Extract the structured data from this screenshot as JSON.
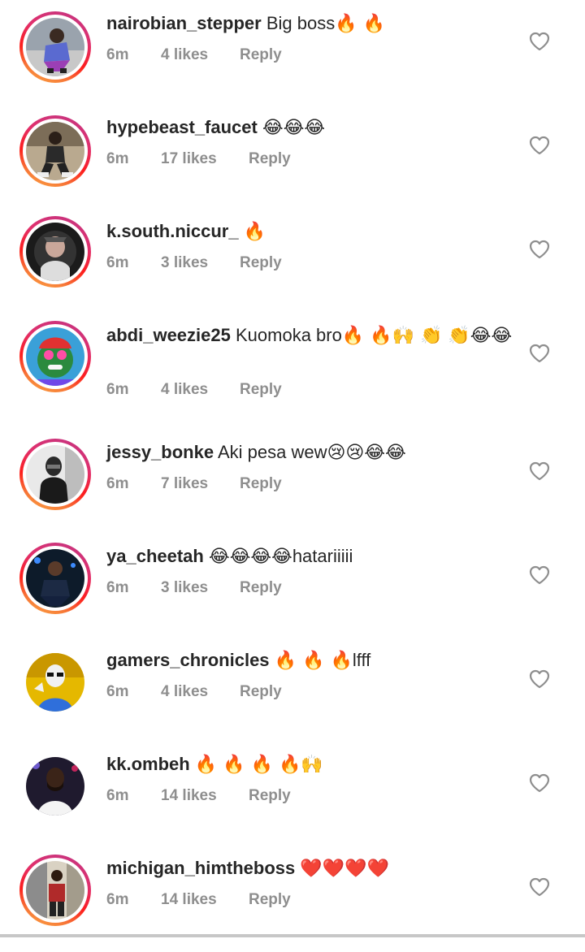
{
  "comments": [
    {
      "username": "nairobian_stepper",
      "text": "Big boss",
      "emoji": "🔥 🔥",
      "time": "6m",
      "likes": "4 likes",
      "reply_label": "Reply"
    },
    {
      "username": "hypebeast_faucet",
      "text": "",
      "emoji": "😂😂😂",
      "time": "6m",
      "likes": "17 likes",
      "reply_label": "Reply"
    },
    {
      "username": "k.south.niccur_",
      "text": "",
      "emoji": "🔥",
      "time": "6m",
      "likes": "3 likes",
      "reply_label": "Reply"
    },
    {
      "username": "abdi_weezie25",
      "text": "Kuomoka bro",
      "emoji": "🔥 🔥🙌 👏 👏😂😂",
      "time": "6m",
      "likes": "4 likes",
      "reply_label": "Reply"
    },
    {
      "username": "jessy_bonke",
      "text": "Aki pesa wew",
      "emoji": "😢😢😂😂",
      "time": "6m",
      "likes": "7 likes",
      "reply_label": "Reply"
    },
    {
      "username": "ya_cheetah",
      "text": "hatariiiii",
      "emoji": "😂😂😂😂",
      "time": "6m",
      "likes": "3 likes",
      "reply_label": "Reply"
    },
    {
      "username": "gamers_chronicles",
      "text": "lfff",
      "emoji": "🔥 🔥 🔥",
      "time": "6m",
      "likes": "4 likes",
      "reply_label": "Reply"
    },
    {
      "username": "kk.ombeh",
      "text": "",
      "emoji": "🔥 🔥 🔥 🔥🙌",
      "time": "6m",
      "likes": "14 likes",
      "reply_label": "Reply"
    },
    {
      "username": "michigan_himtheboss",
      "text": "",
      "emoji": "❤️❤️❤️❤️",
      "time": "6m",
      "likes": "14 likes",
      "reply_label": "Reply"
    }
  ],
  "colors": {
    "text_primary": "#262626",
    "text_secondary": "#8e8e8e",
    "story_ring_start": "#c13584",
    "story_ring_end": "#fcaf45",
    "heart_outline": "#8e8e8e"
  },
  "icons": {
    "like": "heart-outline-icon"
  }
}
